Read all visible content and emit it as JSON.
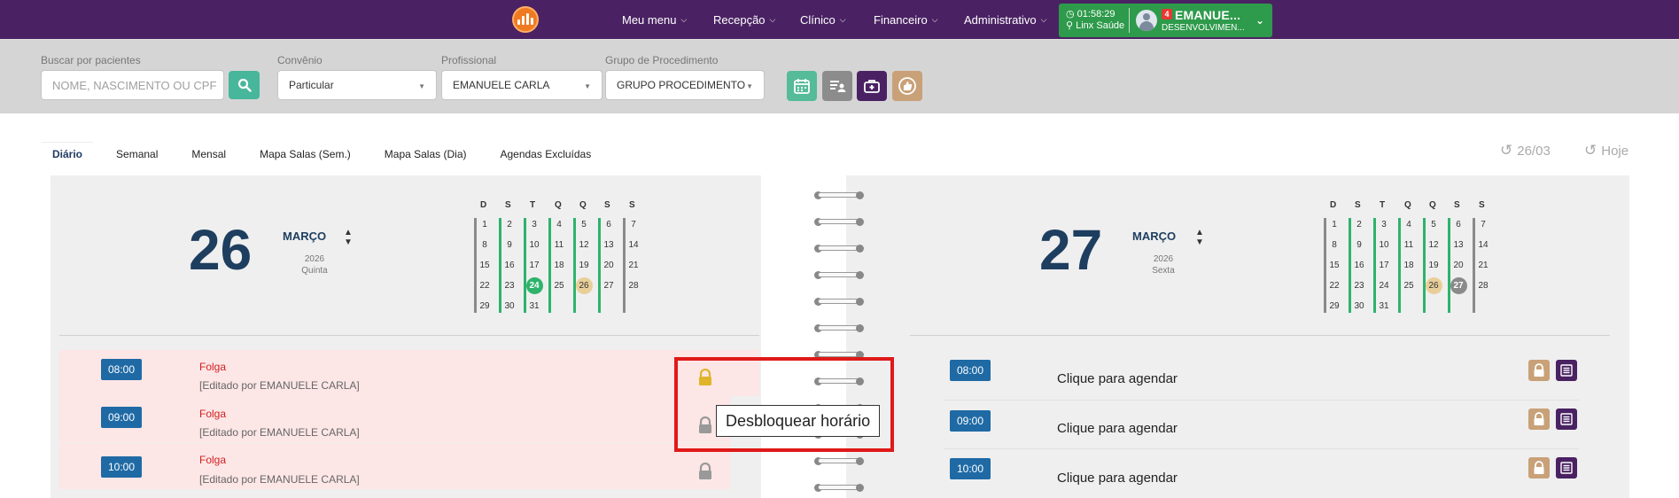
{
  "nav": {
    "menu": [
      {
        "label": "Meu menu"
      },
      {
        "label": "Recepção"
      },
      {
        "label": "Clínico"
      },
      {
        "label": "Financeiro"
      },
      {
        "label": "Administrativo"
      }
    ],
    "clock": "01:58:29",
    "company": "Linx Saúde",
    "notifications": "4",
    "user_name": "EMANUE...",
    "user_role": "DESENVOLVIMEN..."
  },
  "filters": {
    "search_label": "Buscar por pacientes",
    "search_placeholder": "NOME, NASCIMENTO OU CPF",
    "convenio_label": "Convênio",
    "convenio_value": "Particular",
    "profissional_label": "Profissional",
    "profissional_value": "EMANUELE CARLA",
    "grupo_label": "Grupo de Procedimento",
    "grupo_value": "GRUPO PROCEDIMENTO"
  },
  "tabs": [
    {
      "label": "Diário",
      "active": true
    },
    {
      "label": "Semanal"
    },
    {
      "label": "Mensal"
    },
    {
      "label": "Mapa Salas (Sem.)"
    },
    {
      "label": "Mapa Salas (Dia)"
    },
    {
      "label": "Agendas Excluídas"
    }
  ],
  "nav_date": "26/03",
  "today_label": "Hoje",
  "left_page": {
    "day": "26",
    "month": "MARÇO",
    "year": "2026",
    "weekday": "Quinta"
  },
  "right_page": {
    "day": "27",
    "month": "MARÇO",
    "year": "2026",
    "weekday": "Sexta"
  },
  "mini_calendar": {
    "weekday_headers": [
      "D",
      "S",
      "T",
      "Q",
      "Q",
      "S",
      "S"
    ],
    "weeks": [
      [
        "1",
        "2",
        "3",
        "4",
        "5",
        "6",
        "7"
      ],
      [
        "8",
        "9",
        "10",
        "11",
        "12",
        "13",
        "14"
      ],
      [
        "15",
        "16",
        "17",
        "18",
        "19",
        "20",
        "21"
      ],
      [
        "22",
        "23",
        "24",
        "25",
        "26",
        "27",
        "28"
      ],
      [
        "29",
        "30",
        "31",
        "",
        "",
        "",
        ""
      ]
    ],
    "colors": {
      "green": "#2eb36b",
      "gray": "#8a8a8a",
      "today": "#2eb36b",
      "selected": "#e8cf9a"
    }
  },
  "left_slots": [
    {
      "time": "08:00",
      "status": "Folga",
      "edited": "[Editado por EMANUELE CARLA]"
    },
    {
      "time": "09:00",
      "status": "Folga",
      "edited": "[Editado por EMANUELE CARLA]"
    },
    {
      "time": "10:00",
      "status": "Folga",
      "edited": "[Editado por EMANUELE CARLA]"
    }
  ],
  "right_slots": [
    {
      "time": "08:00",
      "text": "Clique para agendar"
    },
    {
      "time": "09:00",
      "text": "Clique para agendar"
    },
    {
      "time": "10:00",
      "text": "Clique para agendar"
    }
  ],
  "tooltip": "Desbloquear horário"
}
